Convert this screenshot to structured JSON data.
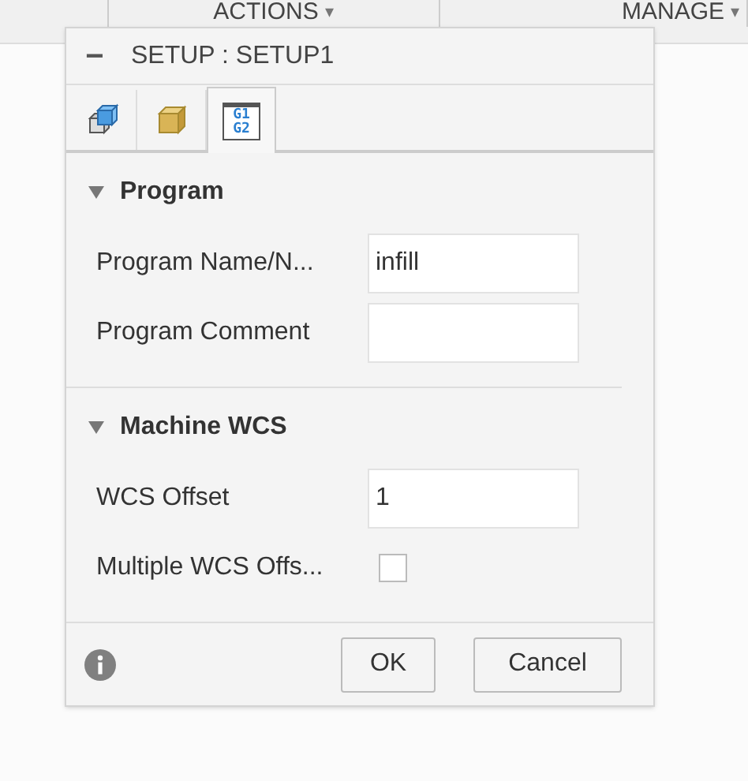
{
  "toolbar": {
    "menus": [
      {
        "label": "ACTIONS",
        "caret": "▾"
      },
      {
        "label": "MANAGE",
        "caret": "▾"
      }
    ]
  },
  "dialog": {
    "title": "SETUP : SETUP1",
    "collapse": "−",
    "tabs": [
      {
        "kind": "setup",
        "selected": false
      },
      {
        "kind": "stock",
        "selected": false
      },
      {
        "kind": "post",
        "selected": true,
        "icon_lines": [
          "G1",
          "G2"
        ]
      }
    ],
    "groups": [
      {
        "title": "Program",
        "expanded": true,
        "rows": [
          {
            "kind": "text",
            "label": "Program Name/N...",
            "value": "infill"
          },
          {
            "kind": "text",
            "label": "Program Comment"
          }
        ]
      },
      {
        "title": "Machine WCS",
        "expanded": true,
        "rows": [
          {
            "kind": "text",
            "label": "WCS Offset",
            "value": "1"
          },
          {
            "kind": "check",
            "label": "Multiple WCS Offs...",
            "checked": false
          }
        ]
      }
    ],
    "buttons": [
      "OK",
      "Cancel"
    ]
  }
}
